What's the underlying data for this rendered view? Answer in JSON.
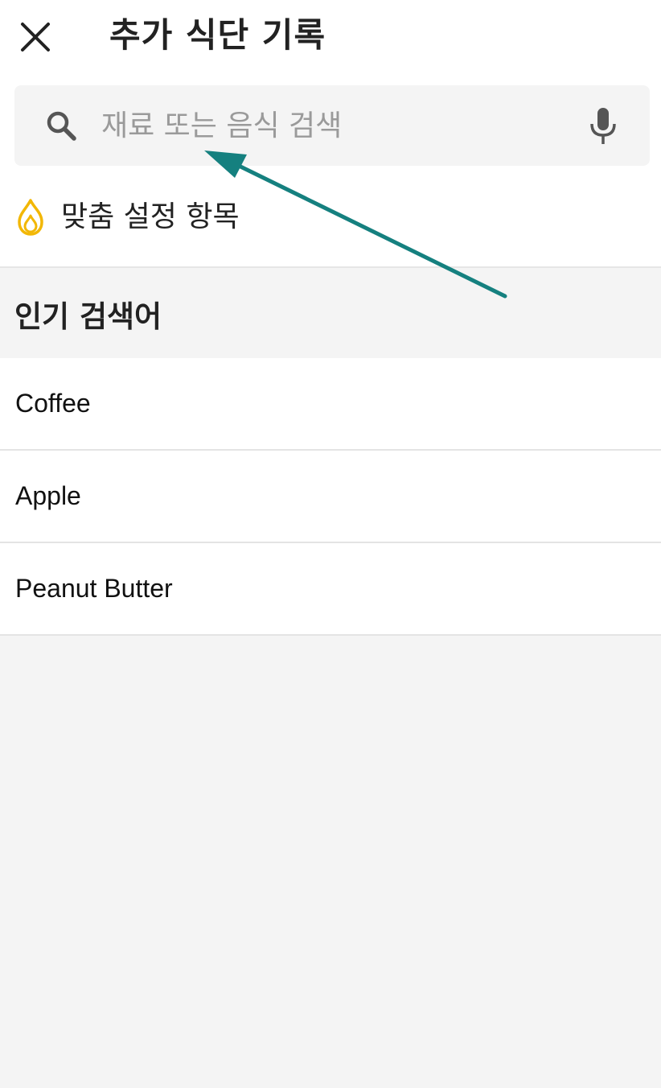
{
  "header": {
    "title": "추가 식단 기록",
    "close_icon": "close-icon"
  },
  "search": {
    "placeholder": "재료 또는 음식 검색",
    "value": "",
    "search_icon": "search-icon",
    "mic_icon": "microphone-icon"
  },
  "custom_items": {
    "icon": "flame-icon",
    "icon_color": "#F2B705",
    "label": "맞춤 설정 항목"
  },
  "popular": {
    "title": "인기 검색어",
    "items": [
      {
        "label": "Coffee"
      },
      {
        "label": "Apple"
      },
      {
        "label": "Peanut Butter"
      }
    ]
  },
  "annotation": {
    "arrow_color": "#15807F"
  }
}
